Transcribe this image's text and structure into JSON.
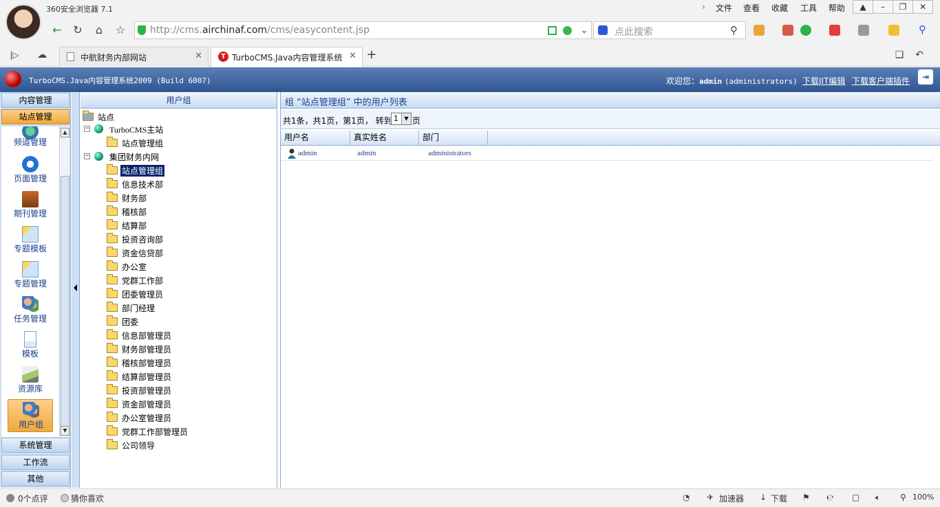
{
  "browser": {
    "app_title": "360安全浏览器 7.1",
    "menu": [
      "文件",
      "查看",
      "收藏",
      "工具",
      "帮助"
    ],
    "url_prefix": "http://cms.",
    "url_host": "airchinaf.com",
    "url_path": "/cms/easycontent.jsp",
    "search_placeholder": "点此搜索",
    "tabs": [
      {
        "label": "中航财务内部网站",
        "active": false
      },
      {
        "label": "TurboCMS.Java内容管理系统",
        "active": true
      }
    ],
    "new_tab": "+"
  },
  "app": {
    "name": "TurboCMS.Java内容管理系统2009 (Build 6007)",
    "welcome_prefix": "欢迎您：",
    "user": "admin",
    "role": "(administrators)",
    "link_editor": "下载JIT编辑",
    "link_plugin": "下载客户端插件"
  },
  "leftnav": {
    "top_bars": [
      "内容管理",
      "站点管理"
    ],
    "tiles": [
      {
        "label": "频道管理",
        "icon": "channel-icon"
      },
      {
        "label": "页面管理",
        "icon": "ie-page-icon"
      },
      {
        "label": "期刊管理",
        "icon": "journal-icon"
      },
      {
        "label": "专题模板",
        "icon": "topic-template-icon"
      },
      {
        "label": "专题管理",
        "icon": "topic-manage-icon"
      },
      {
        "label": "任务管理",
        "icon": "task-users-icon"
      },
      {
        "label": "模板",
        "icon": "template-doc-icon"
      },
      {
        "label": "资源库",
        "icon": "resource-library-icon"
      },
      {
        "label": "用户组",
        "icon": "user-group-icon"
      }
    ],
    "bottom_bars": [
      "系统管理",
      "工作流",
      "其他"
    ]
  },
  "tree": {
    "header": "用户组",
    "root": "站点",
    "site1": "TurboCMS主站",
    "site1_children": [
      "站点管理组"
    ],
    "site2": "集团财务内网",
    "site2_children": [
      "站点管理组",
      "信息技术部",
      "财务部",
      "稽核部",
      "结算部",
      "投资咨询部",
      "资金信贷部",
      "办公室",
      "党群工作部",
      "团委管理员",
      "部门经理",
      "团委",
      "信息部管理员",
      "财务部管理员",
      "稽核部管理员",
      "结算部管理员",
      "投资部管理员",
      "资金部管理员",
      "办公室管理员",
      "党群工作部管理员",
      "公司领导"
    ],
    "selected": "站点管理组"
  },
  "main": {
    "title": "组 “站点管理组” 中的用户列表",
    "pager_text": "共1条，共1页，第1页，  转到",
    "page_value": "1",
    "page_suffix": "页",
    "columns": [
      "用户名",
      "真实姓名",
      "部门"
    ],
    "rows": [
      {
        "username": "admin",
        "realname": "admin",
        "dept": "administrators"
      }
    ]
  },
  "status": {
    "comments": "0个点评",
    "guess": "猜你喜欢",
    "accelerator": "加速器",
    "download": "下载",
    "zoom": "100%"
  }
}
